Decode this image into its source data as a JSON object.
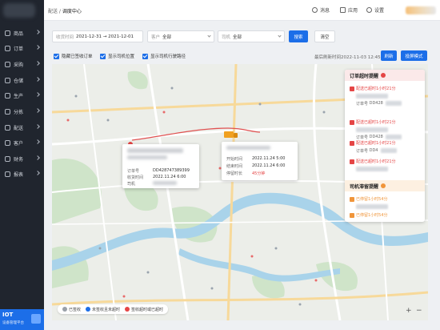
{
  "sidebar": {
    "items": [
      {
        "label": "商品",
        "icon": "grid-icon"
      },
      {
        "label": "订单",
        "icon": "order-icon"
      },
      {
        "label": "采购",
        "icon": "cart-icon"
      },
      {
        "label": "仓储",
        "icon": "warehouse-icon"
      },
      {
        "label": "生产",
        "icon": "factory-icon"
      },
      {
        "label": "分拣",
        "icon": "sort-icon"
      },
      {
        "label": "配送",
        "icon": "truck-icon"
      },
      {
        "label": "客户",
        "icon": "customer-icon"
      },
      {
        "label": "财务",
        "icon": "finance-icon"
      },
      {
        "label": "报表",
        "icon": "report-icon"
      }
    ],
    "footer": {
      "title": "IOT",
      "subtitle": "设备管理平台"
    }
  },
  "topbar": {
    "breadcrumb_parent": "配送",
    "breadcrumb_sep": " / ",
    "breadcrumb_current": "调度中心",
    "message_label": "消息",
    "apps_label": "应用",
    "settings_label": "设置"
  },
  "filter": {
    "time_label": "收货时间",
    "time_value": "2021-12-31 → 2021-12-01",
    "customer_label": "客户",
    "customer_value": "全部",
    "driver_label": "司机",
    "driver_value": "全部",
    "search_label": "搜索",
    "clear_label": "清空"
  },
  "options": {
    "hide_finished": "隐藏已签收订单",
    "show_driver_pos": "显示司机位置",
    "show_driver_route": "显示司机行驶路径",
    "refresh_time": "最后刷新时间2022-11-03 12:45",
    "refresh_label": "刷新",
    "fullscreen_label": "投屏模式"
  },
  "popup_order": {
    "order_no_label": "订单号",
    "order_no": "DD428747389399",
    "receive_time_label": "收货时间",
    "receive_time": "2022.11.24 6:00",
    "driver_label": "司机"
  },
  "popup_driver": {
    "start_label": "开始时间",
    "start_time": "2022.11.24 5:00",
    "end_label": "结束时间",
    "end_time": "2022.11.24 6:00",
    "stay_label": "停留时长",
    "stay_value": "45分钟"
  },
  "alerts": {
    "order_timeout_title": "订单超时提醒",
    "order_timeout_items": [
      {
        "text": "配送已超时1小时21分",
        "sub_label": "订单号",
        "sub_value": "DD428"
      },
      {
        "text": "配送已超时1小时21分",
        "sub_label": "订单号",
        "sub_value": "DD428"
      },
      {
        "text": "配送已超时1小时21分",
        "sub_label": "订单号",
        "sub_value": "DD4"
      },
      {
        "text": "配送已超时1小时21分",
        "sub_label": "",
        "sub_value": ""
      }
    ],
    "driver_stay_title": "司机滞留提醒",
    "driver_stay_items": [
      {
        "text": "已停留1小时54分"
      },
      {
        "text": "已停留1小时54分"
      }
    ]
  },
  "legend": {
    "items": [
      {
        "label": "已签收",
        "color": "#9aa0a8"
      },
      {
        "label": "未签收且未超时",
        "color": "#1c6ee8"
      },
      {
        "label": "签收超时或已超时",
        "color": "#e54545"
      }
    ]
  },
  "map": {
    "zoom_in": "+",
    "zoom_out": "−"
  },
  "colors": {
    "accent": "#1c6ee8",
    "danger": "#e54545",
    "warning": "#f0953a"
  }
}
